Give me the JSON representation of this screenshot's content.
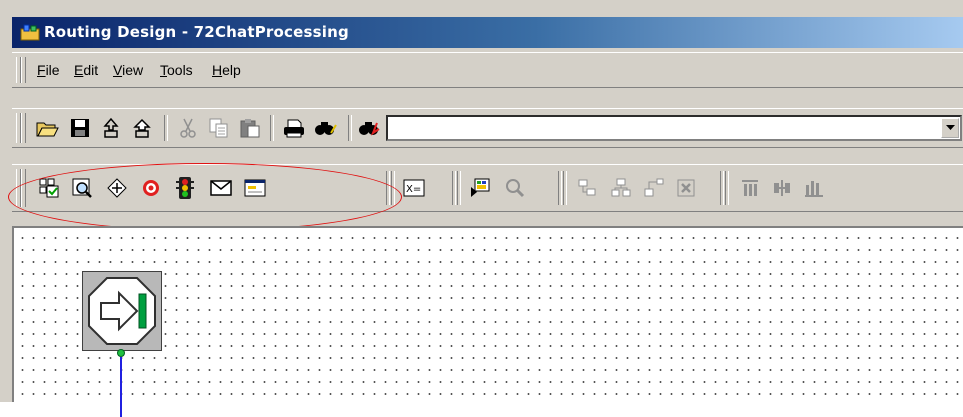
{
  "window": {
    "title": "Routing Design - 72ChatProcessing"
  },
  "menu": {
    "items": [
      {
        "label_u": "F",
        "label_rest": "ile"
      },
      {
        "label_u": "E",
        "label_rest": "dit"
      },
      {
        "label_u": "V",
        "label_rest": "iew"
      },
      {
        "label_u": "T",
        "label_rest": "ools"
      },
      {
        "label_u": "H",
        "label_rest": "elp"
      }
    ]
  },
  "toolbar1": {
    "buttons": [
      "open-folder-icon",
      "save-disk-icon",
      "import-icon",
      "export-icon",
      "cut-icon",
      "copy-icon",
      "paste-icon",
      "print-icon",
      "find-icon",
      "find-next-icon"
    ],
    "combo_value": ""
  },
  "toolbar2": {
    "buttons": [
      "checklist-icon",
      "zoom-icon",
      "route-icon",
      "target-icon",
      "traffic-light-icon",
      "envelope-icon",
      "form-icon",
      "variable-icon",
      "object-icon",
      "search-disabled-icon",
      "align-icon",
      "connect-icon",
      "branch-icon",
      "delete-icon",
      "column-icon",
      "split-icon",
      "bars-icon"
    ]
  },
  "colors": {
    "accent": "#0a246a",
    "highlight": "#e01010"
  }
}
